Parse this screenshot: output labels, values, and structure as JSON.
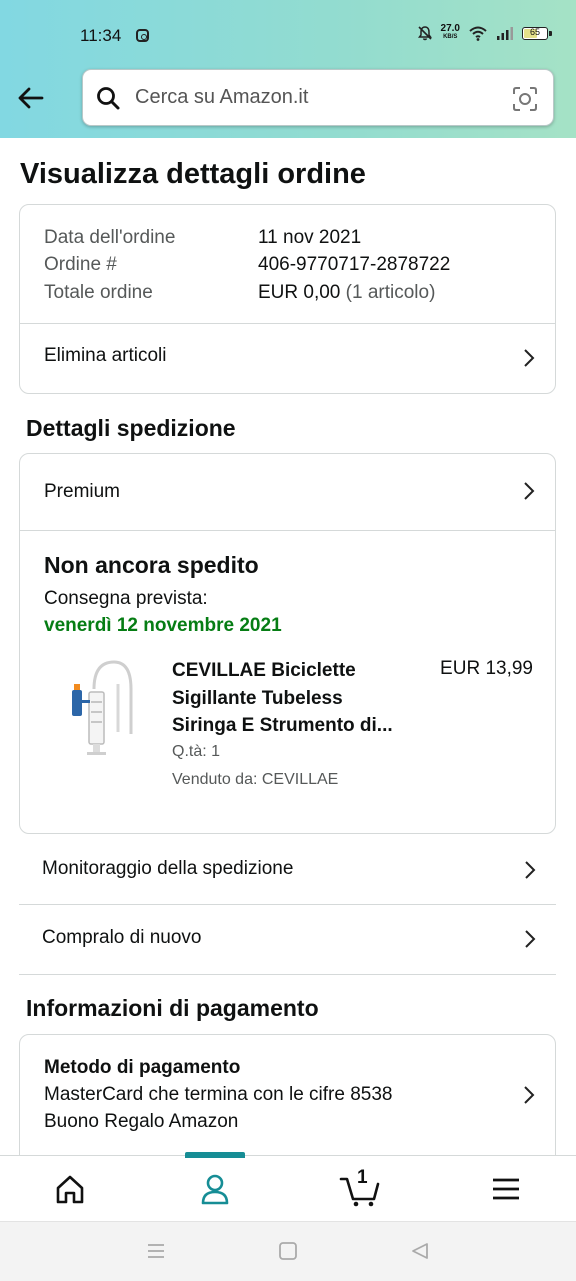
{
  "status_bar": {
    "time": "11:34",
    "speed_value": "27.0",
    "speed_unit": "KB/S",
    "battery": "65"
  },
  "search": {
    "placeholder": "Cerca su Amazon.it"
  },
  "page": {
    "title": "Visualizza dettagli ordine"
  },
  "order": {
    "date_label": "Data dell'ordine",
    "date_value": "11 nov 2021",
    "number_label": "Ordine #",
    "number_value": "406-9770717-2878722",
    "total_label": "Totale ordine",
    "total_value": "EUR 0,00",
    "total_count": "(1 articolo)",
    "delete_link": "Elimina articoli"
  },
  "shipping": {
    "heading": "Dettagli spedizione",
    "service": "Premium",
    "status": "Non ancora spedito",
    "delivery_label": "Consegna prevista:",
    "delivery_date": "venerdì 12 novembre 2021",
    "product": {
      "title_line1": "CEVILLAE Biciclette",
      "title_line2": "Sigillante Tubeless",
      "title_line3": "Siringa E Strumento di...",
      "price": "EUR 13,99",
      "qty": "Q.tà: 1",
      "seller": "Venduto da: CEVILLAE"
    },
    "track_link": "Monitoraggio della spedizione",
    "buy_again_link": "Compralo di nuovo"
  },
  "payment": {
    "heading": "Informazioni di pagamento",
    "method_label": "Metodo di pagamento",
    "line1": "MasterCard che termina con le cifre 8538",
    "line2": "Buono Regalo Amazon"
  },
  "tabbar": {
    "cart_count": "1",
    "accent": "#168d95"
  },
  "colors": {
    "delivery_green": "#067d14",
    "header_gradient_start": "#82d8e2",
    "header_gradient_end": "#a5e2c6"
  }
}
